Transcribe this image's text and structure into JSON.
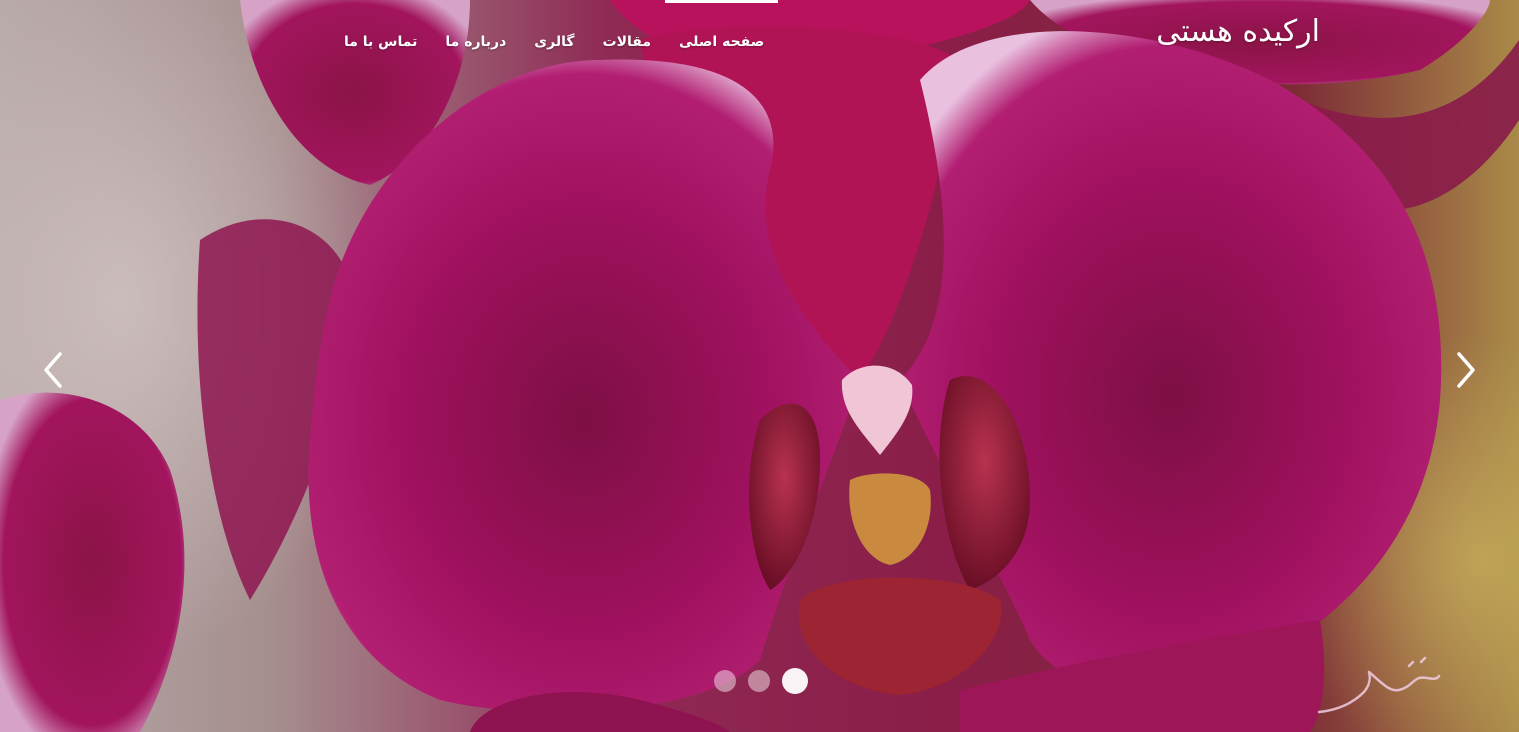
{
  "site": {
    "brand": "ارکیده هستی"
  },
  "nav": {
    "items": [
      {
        "label": "صفحه اصلی",
        "active": true
      },
      {
        "label": "مقالات",
        "active": false
      },
      {
        "label": "گالری",
        "active": false
      },
      {
        "label": "درباره ما",
        "active": false
      },
      {
        "label": "تماس با ما",
        "active": false
      }
    ]
  },
  "slider": {
    "slide_count": 3,
    "active_slide": 3,
    "prev_icon": "chevron-left-icon",
    "next_icon": "chevron-right-icon"
  },
  "colors": {
    "petal": "#a0115f",
    "petal_edge": "#e9c1df",
    "text": "#ffffff"
  }
}
